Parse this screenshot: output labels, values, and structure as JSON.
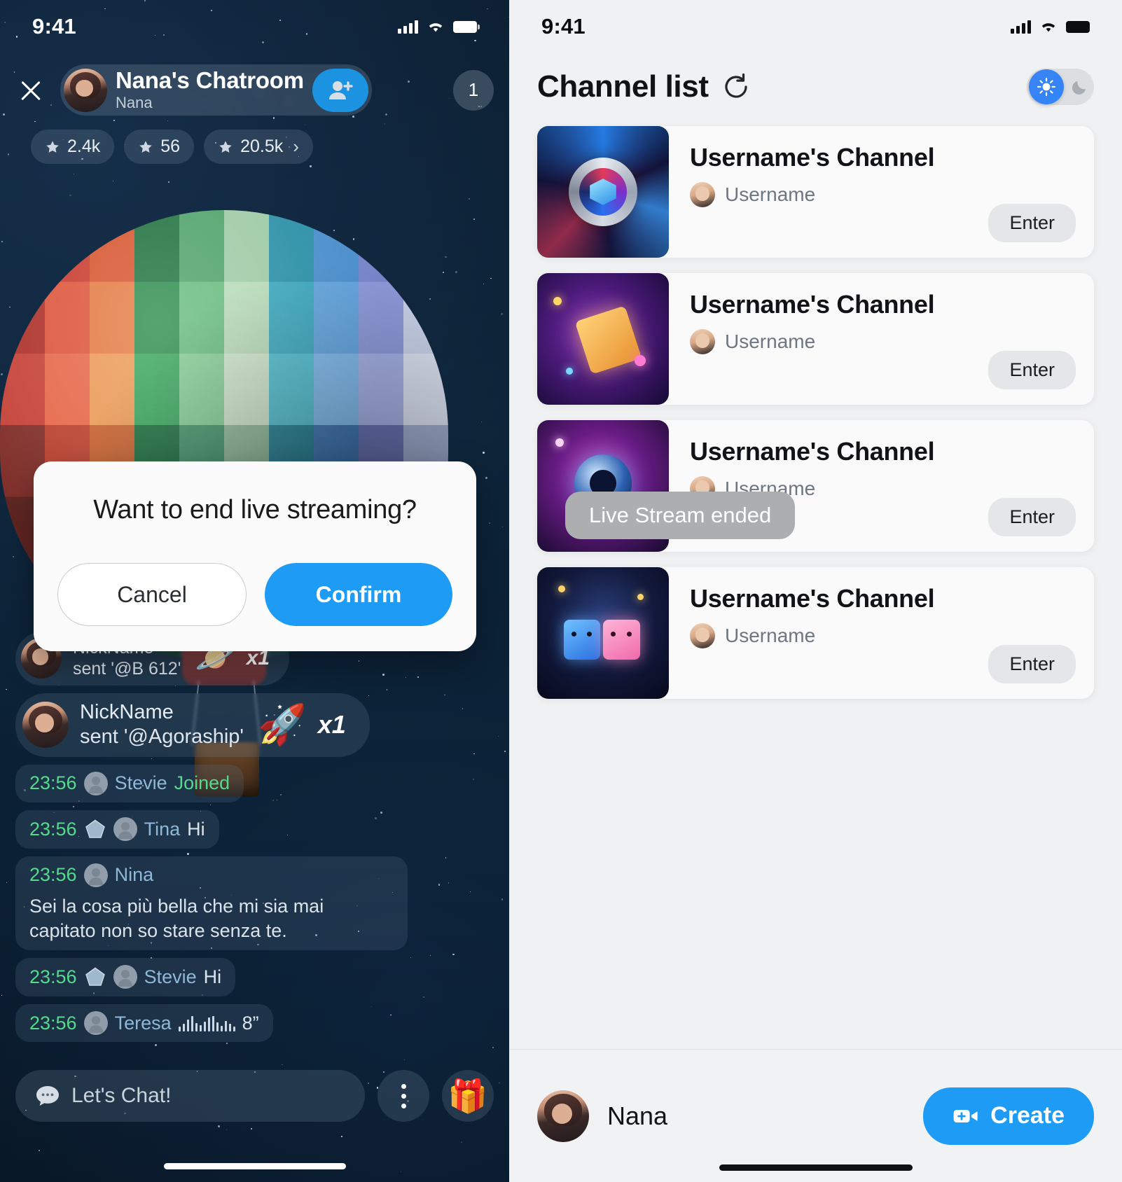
{
  "left_phone": {
    "status_bar": {
      "time": "9:41",
      "signal_icon": "cellular-bars-icon",
      "wifi_icon": "wifi-icon",
      "battery_icon": "battery-full-icon"
    },
    "close_label": "close-icon",
    "host": {
      "title": "Nana's Chatroom",
      "subtitle": "Nana",
      "follow_icon": "add-person-icon",
      "viewer_count": "1"
    },
    "stats": [
      {
        "icon": "star-icon",
        "value": "2.4k"
      },
      {
        "icon": "star-icon",
        "value": "56"
      },
      {
        "icon": "star-icon",
        "value": "20.5k",
        "chevron": "›"
      }
    ],
    "dialog": {
      "title": "Want to end live streaming?",
      "cancel_label": "Cancel",
      "confirm_label": "Confirm",
      "confirm_color": "#1d9bf5"
    },
    "gift_messages": [
      {
        "name": "NickName",
        "action": "sent '@B 612'",
        "emoji": "🪐",
        "multiplier": "x1"
      },
      {
        "name": "NickName",
        "action": "sent '@Agoraship'",
        "emoji": "🚀",
        "multiplier": "x1"
      }
    ],
    "chat_messages": [
      {
        "time": "23:56",
        "level": false,
        "name": "Stevie",
        "body": "",
        "join": "Joined",
        "type": "join"
      },
      {
        "time": "23:56",
        "level": true,
        "name": "Tina",
        "body": "Hi",
        "type": "text"
      },
      {
        "time": "23:56",
        "level": false,
        "name": "Nina",
        "body": "Sei la cosa più bella che mi sia mai capitato non so stare senza te.",
        "type": "text"
      },
      {
        "time": "23:56",
        "level": true,
        "name": "Stevie",
        "body": "Hi",
        "type": "text"
      },
      {
        "time": "23:56",
        "level": false,
        "name": "Teresa",
        "body": "",
        "duration": "8”",
        "type": "voice"
      }
    ],
    "composer": {
      "placeholder": "Let's Chat!",
      "bubble_icon": "chat-bubble-icon",
      "more_icon": "more-vertical-icon",
      "gift_icon": "🎁"
    },
    "colors": {
      "time_green": "#55d98b",
      "name_blue": "#8fb8d8",
      "accent": "#1b93e0"
    }
  },
  "right_phone": {
    "status_bar": {
      "time": "9:41",
      "signal_icon": "cellular-bars-icon",
      "wifi_icon": "wifi-icon",
      "battery_icon": "battery-full-icon"
    },
    "header": {
      "title": "Channel list",
      "refresh_icon": "refresh-icon",
      "theme_light_icon": "sun-icon",
      "theme_dark_icon": "moon-icon",
      "theme_active": "light"
    },
    "channels": [
      {
        "name": "Username's Channel",
        "user": "Username",
        "enter_label": "Enter",
        "thumb": "agora-logo-thumb"
      },
      {
        "name": "Username's Channel",
        "user": "Username",
        "enter_label": "Enter",
        "thumb": "cracker-thumb"
      },
      {
        "name": "Username's Channel",
        "user": "Username",
        "enter_label": "Enter",
        "thumb": "camera-lens-thumb",
        "toast": "Live Stream ended"
      },
      {
        "name": "Username's Channel",
        "user": "Username",
        "enter_label": "Enter",
        "thumb": "dice-characters-thumb"
      }
    ],
    "bottom_bar": {
      "user": "Nana",
      "create_label": "Create",
      "create_icon": "video-camera-plus-icon",
      "create_color": "#1d9bf5"
    }
  }
}
